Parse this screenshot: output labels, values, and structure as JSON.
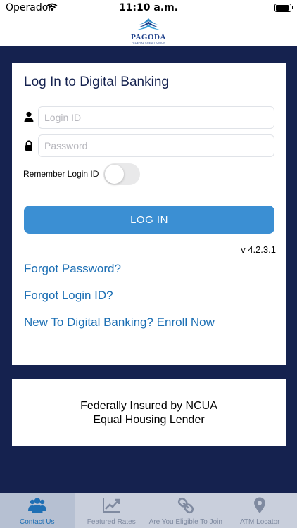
{
  "status_bar": {
    "carrier": "Operador",
    "time": "11:10 a.m."
  },
  "header": {
    "logo_name": "PAGODA",
    "logo_subtitle": "FEDERAL CREDIT UNION"
  },
  "login": {
    "title": "Log In to Digital Banking",
    "login_id": {
      "value": "",
      "placeholder": "Login ID",
      "icon": "user-icon"
    },
    "password": {
      "value": "",
      "placeholder": "Password",
      "icon": "lock-icon"
    },
    "remember_label": "Remember Login ID",
    "remember_on": false,
    "login_button": "LOG IN",
    "version": "v 4.2.3.1",
    "links": {
      "forgot_password": "Forgot Password?",
      "forgot_login_id": "Forgot Login ID?",
      "enroll": "New To Digital Banking? Enroll Now"
    }
  },
  "footer_info": {
    "line1": "Federally Insured by NCUA",
    "line2": "Equal Housing Lender"
  },
  "tab_bar": {
    "active": "contact-us",
    "tabs": [
      {
        "label": "Contact Us",
        "icon": "people-icon"
      },
      {
        "label": "Featured Rates",
        "icon": "trend-chart-icon"
      },
      {
        "label": "Are You Eligible To Join",
        "icon": "link-icon"
      },
      {
        "label": "ATM Locator",
        "icon": "location-pin-icon"
      }
    ]
  },
  "colors": {
    "navy": "#15224f",
    "accent": "#3b8fd3",
    "link": "#1c6fb4",
    "tab_active": "#1f6fb4",
    "tab_inactive": "#7f8aa0"
  }
}
